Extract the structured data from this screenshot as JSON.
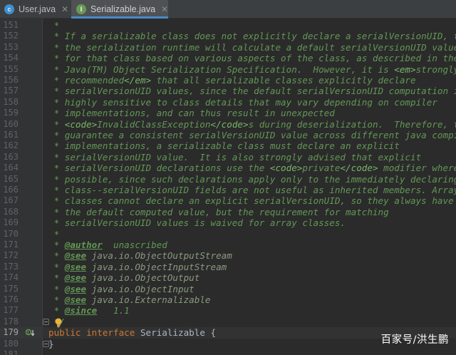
{
  "tabs": [
    {
      "label": "User.java",
      "icon": "class-icon"
    },
    {
      "label": "Serializable.java",
      "icon": "interface-icon",
      "active": true
    }
  ],
  "lines": [
    {
      "n": "151",
      "text": " *"
    },
    {
      "n": "152",
      "text": " * If a serializable class does not explicitly declare a serialVersionUID, then"
    },
    {
      "n": "153",
      "text": " * the serialization runtime will calculate a default serialVersionUID value"
    },
    {
      "n": "154",
      "text": " * for that class based on various aspects of the class, as described in the"
    },
    {
      "n": "155",
      "pre": " * Java(TM) Object Serialization Specification.  However, it is ",
      "t1": "<em>",
      "post": "strongly"
    },
    {
      "n": "156",
      "pre": " * recommended",
      "t1": "</em>",
      "post": " that all serializable classes explicitly declare"
    },
    {
      "n": "157",
      "text": " * serialVersionUID values, since the default serialVersionUID computation is"
    },
    {
      "n": "158",
      "text": " * highly sensitive to class details that may vary depending on compiler"
    },
    {
      "n": "159",
      "text": " * implementations, and can thus result in unexpected"
    },
    {
      "n": "160",
      "pre": " * ",
      "t1": "<code>",
      "mid": "InvalidClassException",
      "t2": "</code>",
      "post": "s during deserialization.  Therefore, to"
    },
    {
      "n": "161",
      "text": " * guarantee a consistent serialVersionUID value across different java compiler"
    },
    {
      "n": "162",
      "text": " * implementations, a serializable class must declare an explicit"
    },
    {
      "n": "163",
      "text": " * serialVersionUID value.  It is also strongly advised that explicit"
    },
    {
      "n": "164",
      "pre": " * serialVersionUID declarations use the ",
      "t1": "<code>",
      "mid": "private",
      "t2": "</code>",
      "post": " modifier where"
    },
    {
      "n": "165",
      "text": " * possible, since such declarations apply only to the immediately declaring"
    },
    {
      "n": "166",
      "text": " * class--serialVersionUID fields are not useful as inherited members. Array"
    },
    {
      "n": "167",
      "text": " * classes cannot declare an explicit serialVersionUID, so they always have"
    },
    {
      "n": "168",
      "text": " * the default computed value, but the requirement for matching"
    },
    {
      "n": "169",
      "text": " * serialVersionUID values is waived for array classes."
    },
    {
      "n": "170",
      "text": " *"
    },
    {
      "n": "171",
      "pre": " * ",
      "link": "@author",
      "post": "  unascribed"
    },
    {
      "n": "172",
      "pre": " * ",
      "link": "@see",
      "ref": " java.io.ObjectOutputStream"
    },
    {
      "n": "173",
      "pre": " * ",
      "link": "@see",
      "ref": " java.io.ObjectInputStream"
    },
    {
      "n": "174",
      "pre": " * ",
      "link": "@see",
      "ref": " java.io.ObjectOutput"
    },
    {
      "n": "175",
      "pre": " * ",
      "link": "@see",
      "ref": " java.io.ObjectInput"
    },
    {
      "n": "176",
      "pre": " * ",
      "link": "@see",
      "ref": " java.io.Externalizable"
    },
    {
      "n": "177",
      "pre": " * ",
      "link": "@since",
      "post": "   1.1"
    },
    {
      "n": "178",
      "text": " */"
    },
    {
      "n": "179",
      "kw1": "public",
      "kw2": "interface",
      "cls": "Serializable",
      "brace": " {"
    },
    {
      "n": "180",
      "close": "}"
    },
    {
      "n": "181",
      "text": ""
    }
  ],
  "watermark": "百家号/洪生鹏",
  "colors": {
    "background": "#2b2b2b",
    "doc_comment": "#629755",
    "keyword": "#cc7832",
    "identifier": "#a9b7c6"
  }
}
